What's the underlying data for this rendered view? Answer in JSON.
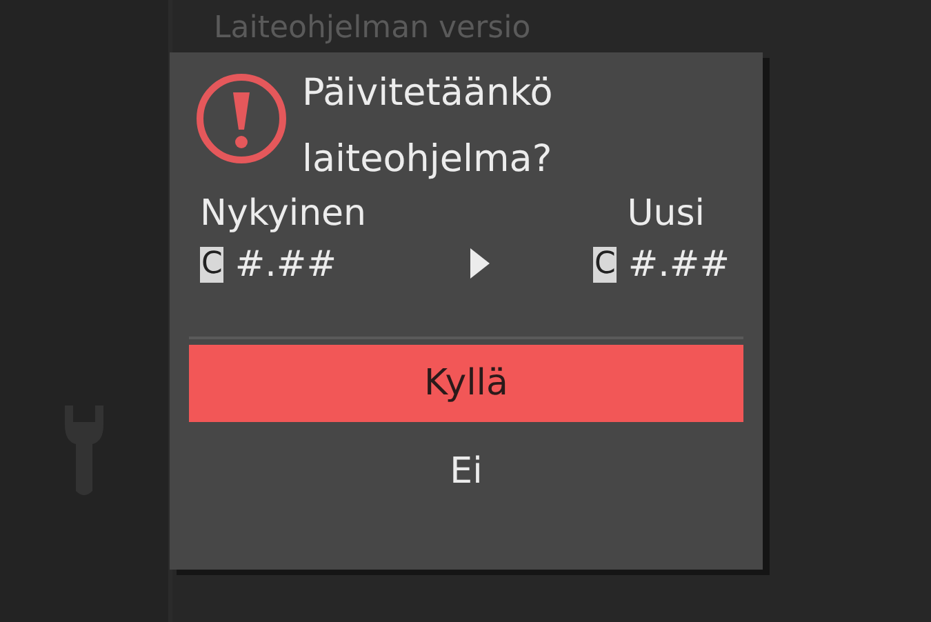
{
  "background_title": "Laiteohjelman versio",
  "dialog": {
    "title": "Päivitetäänkö laiteohjelma?",
    "versions": [
      {
        "label": "Nykyinen",
        "badge": "C",
        "version": "#.##"
      },
      {
        "label": "Uusi",
        "badge": "C",
        "version": "#.##"
      }
    ],
    "options": [
      {
        "label": "Kyllä",
        "selected": true
      },
      {
        "label": "Ei",
        "selected": false
      }
    ]
  }
}
